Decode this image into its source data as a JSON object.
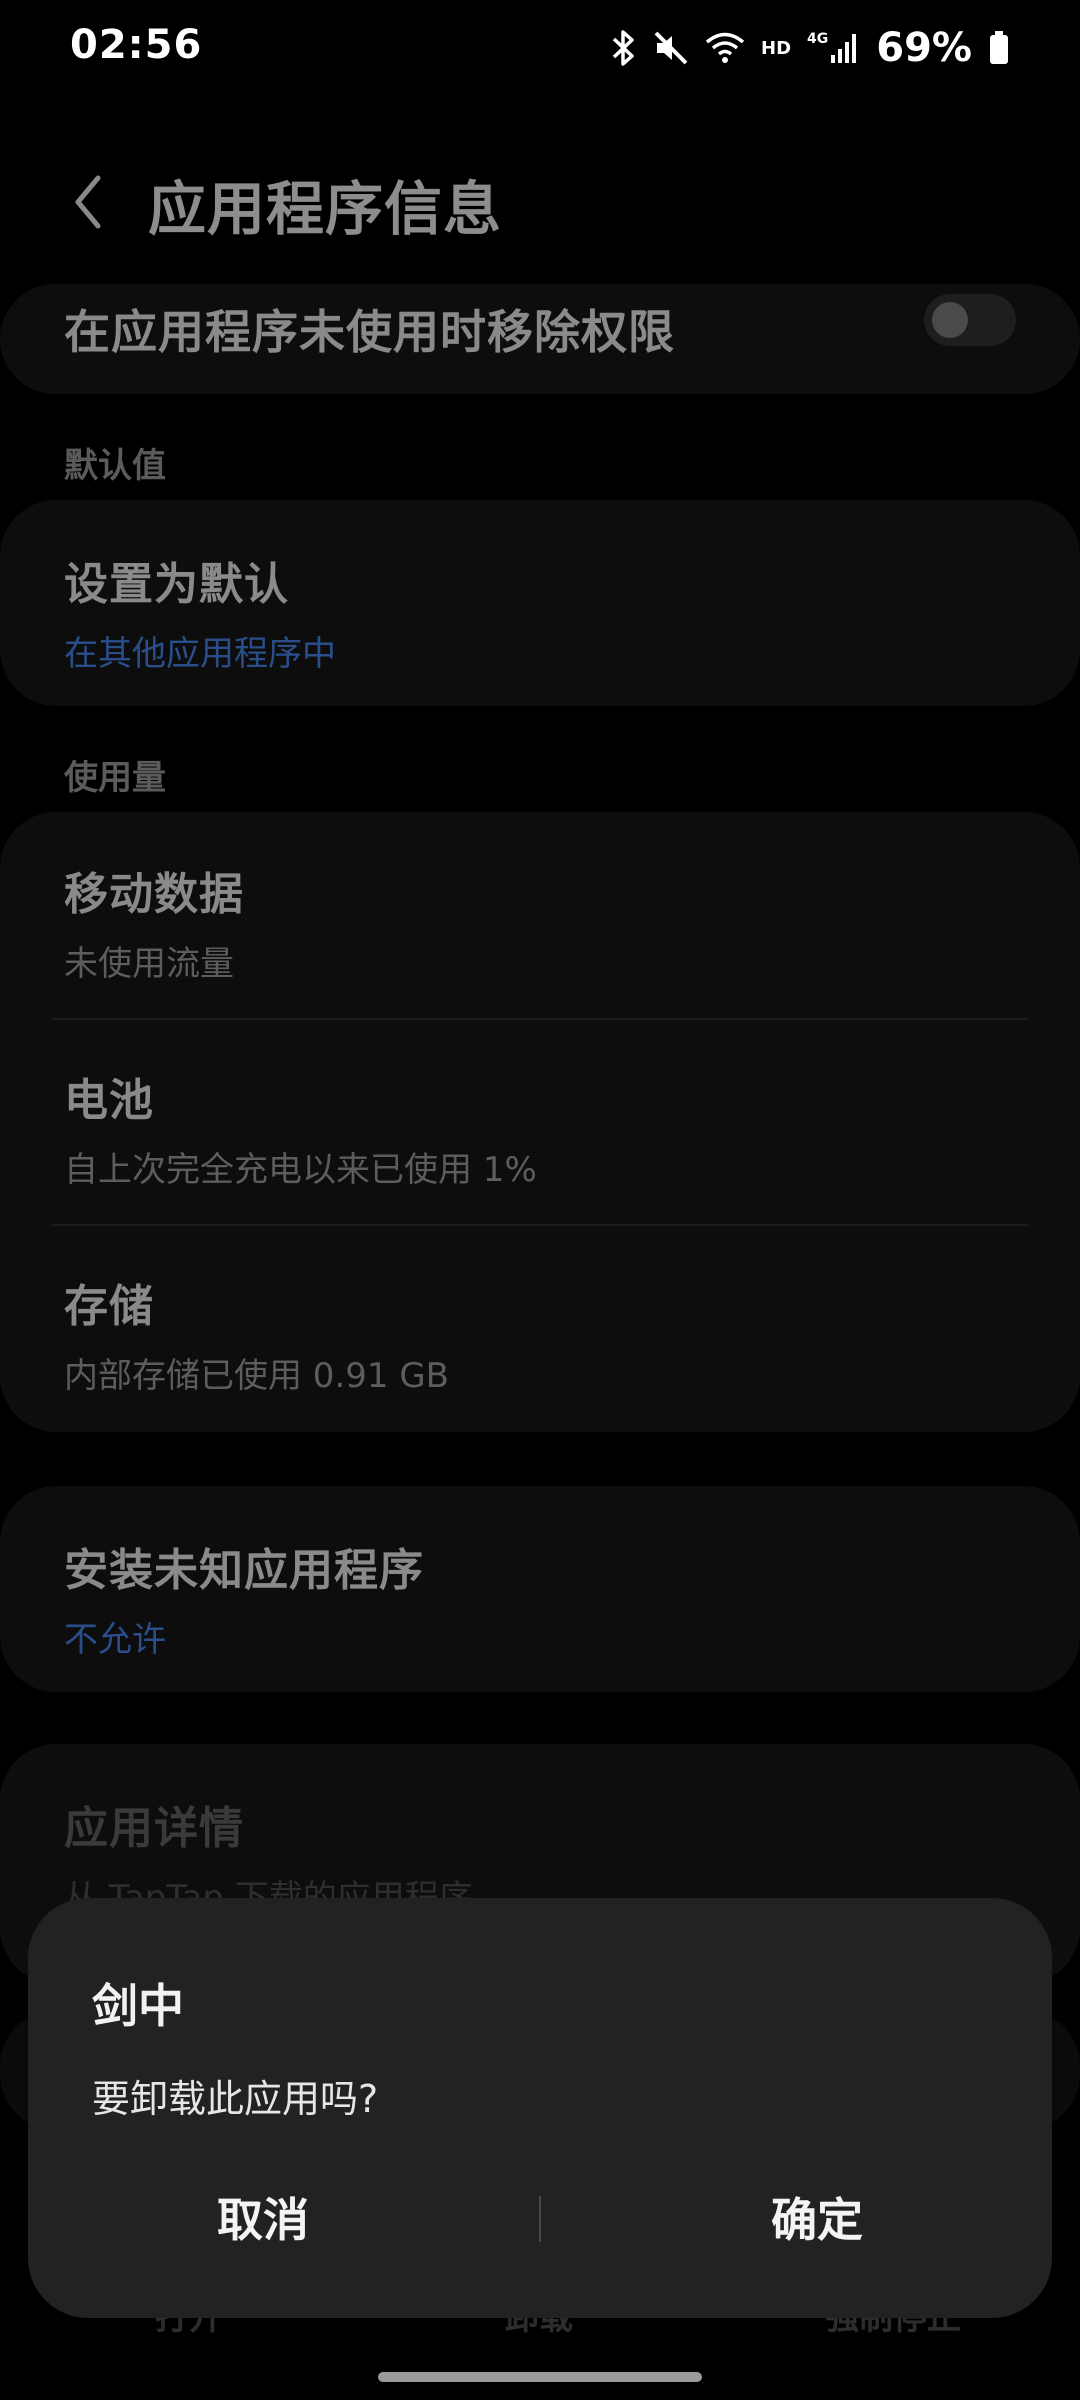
{
  "status_bar": {
    "time": "02:56",
    "hd": "HD",
    "network": "4G",
    "battery": "69%"
  },
  "header": {
    "title": "应用程序信息"
  },
  "permissions": {
    "remove_when_unused_label": "在应用程序未使用时移除权限",
    "toggle_on": false
  },
  "defaults": {
    "section": "默认值",
    "set_default_title": "设置为默认",
    "set_default_value": "在其他应用程序中"
  },
  "usage": {
    "section": "使用量",
    "mobile_data_title": "移动数据",
    "mobile_data_value": "未使用流量",
    "battery_title": "电池",
    "battery_value": "自上次完全充电以来已使用 1%",
    "storage_title": "存储",
    "storage_value": "内部存储已使用 0.91 GB"
  },
  "install_unknown": {
    "title": "安装未知应用程序",
    "value": "不允许"
  },
  "app_details": {
    "title": "应用详情",
    "value": "从 TapTap 下载的应用程序"
  },
  "bottom_actions": {
    "open": "打开",
    "uninstall": "卸载",
    "force_stop": "强制停止"
  },
  "dialog": {
    "title": "剑中",
    "message": "要卸载此应用吗?",
    "cancel": "取消",
    "confirm": "确定"
  },
  "colors": {
    "background": "#000000",
    "card": "#0d0d0d",
    "dialog": "#222223",
    "link_blue": "#2a4e8a"
  }
}
